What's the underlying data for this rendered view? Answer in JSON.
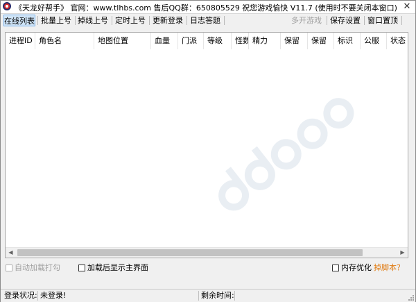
{
  "window": {
    "title": "《天龙好帮手》 官网：www.tlhbs.com  售后QQ群：650805529 祝您游戏愉快 V11.7  (使用时不要关闭本窗口)"
  },
  "toolbar": {
    "buttons": [
      {
        "label": "在线列表",
        "active": true
      },
      {
        "label": "批量上号"
      },
      {
        "label": "掉线上号"
      },
      {
        "label": "定时上号"
      },
      {
        "label": "更新登录"
      },
      {
        "label": "日志答题"
      }
    ],
    "right_buttons": [
      {
        "label": "多开游戏",
        "disabled": true
      },
      {
        "label": "保存设置"
      },
      {
        "label": "窗口置顶"
      }
    ]
  },
  "list": {
    "columns": [
      "进程ID",
      "角色名",
      "地图位置",
      "血量",
      "门派",
      "等级",
      "怪数",
      "精力",
      "保留",
      "保留",
      "标识",
      "公服",
      "状态"
    ]
  },
  "options": {
    "auto_load": "自动加载打勾",
    "show_main": "加载后显示主界面",
    "mem_opt": "内存优化",
    "script_link": "掉脚本？"
  },
  "status": {
    "login_label": "登录状况:",
    "login_value": "未登录!",
    "remain_label": "剩余时间:",
    "remain_value": ""
  },
  "colors": {
    "active_tab_bg": "#cfe4f7",
    "link": "#e07a10",
    "icon_red": "#d62a2a"
  }
}
